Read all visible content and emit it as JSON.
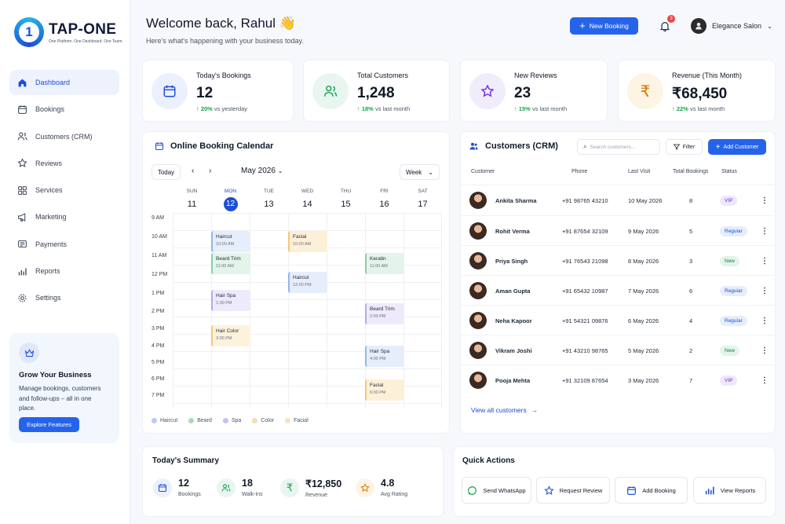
{
  "brand": {
    "name": "TAP-ONE",
    "tagline": "One Platform. One Dashboard. One Team."
  },
  "sidebar": {
    "items": [
      {
        "label": "Dashboard",
        "icon": "home-icon"
      },
      {
        "label": "Bookings",
        "icon": "calendar-icon"
      },
      {
        "label": "Customers (CRM)",
        "icon": "users-icon"
      },
      {
        "label": "Reviews",
        "icon": "star-icon"
      },
      {
        "label": "Services",
        "icon": "grid-icon"
      },
      {
        "label": "Marketing",
        "icon": "megaphone-icon"
      },
      {
        "label": "Payments",
        "icon": "payments-icon"
      },
      {
        "label": "Reports",
        "icon": "bar-chart-icon"
      },
      {
        "label": "Settings",
        "icon": "gear-icon"
      }
    ],
    "promo": {
      "title": "Grow Your Business",
      "text": "Manage bookings, customers and follow-ups – all in one place.",
      "button": "Explore Features"
    }
  },
  "header": {
    "title": "Welcome back, Rahul 👋",
    "subtitle": "Here's what's happening with your business today.",
    "new_booking": "New Booking",
    "notifications": "3",
    "salon": "Elegance Salon"
  },
  "stats": [
    {
      "label": "Today's Bookings",
      "value": "12",
      "change": "20%",
      "compare": "vs yesterday",
      "color": "#eaf0fd"
    },
    {
      "label": "Total Customers",
      "value": "1,248",
      "change": "18%",
      "compare": "vs last month",
      "color": "#e8f6ef"
    },
    {
      "label": "New Reviews",
      "value": "23",
      "change": "15%",
      "compare": "vs last month",
      "color": "#f0ecfb"
    },
    {
      "label": "Revenue (This Month)",
      "value": "₹68,450",
      "change": "22%",
      "compare": "vs last month",
      "color": "#fdf4e3"
    }
  ],
  "calendar": {
    "title": "Online Booking Calendar",
    "today": "Today",
    "month": "May 2026",
    "view": "Week",
    "days": [
      {
        "n": "SUN",
        "d": "11"
      },
      {
        "n": "MON",
        "d": "12"
      },
      {
        "n": "TUE",
        "d": "13"
      },
      {
        "n": "WED",
        "d": "14"
      },
      {
        "n": "THU",
        "d": "15"
      },
      {
        "n": "FRI",
        "d": "16"
      },
      {
        "n": "SAT",
        "d": "17"
      }
    ],
    "hours": [
      "9 AM",
      "10 AM",
      "11 AM",
      "12 PM",
      "1 PM",
      "2 PM",
      "3 PM",
      "4 PM",
      "5 PM",
      "6 PM",
      "7 PM"
    ],
    "events": [
      {
        "name": "Haircut",
        "time": "10:00 AM"
      },
      {
        "name": "Beard Trim",
        "time": "11:00 AM"
      },
      {
        "name": "Hair Spa",
        "time": "1:00 PM"
      },
      {
        "name": "Hair Color",
        "time": "3:00 PM"
      },
      {
        "name": "Facial",
        "time": "10:00 AM"
      },
      {
        "name": "Haircut",
        "time": "12:00 PM"
      },
      {
        "name": "Keratin",
        "time": "11:00 AM"
      },
      {
        "name": "Beard Trim",
        "time": "2:00 PM"
      },
      {
        "name": "Hair Spa",
        "time": "4:00 PM"
      },
      {
        "name": "Facial",
        "time": "6:00 PM"
      }
    ],
    "legend": [
      "Haircut",
      "Beard",
      "Spa",
      "Color",
      "Facial"
    ]
  },
  "crm": {
    "title": "Customers (CRM)",
    "search_placeholder": "Search customers...",
    "filter": "Filter",
    "add": "Add Customer",
    "columns": [
      "Customer",
      "Phone",
      "Last Visit",
      "Total Bookings",
      "Status"
    ],
    "rows": [
      {
        "name": "Ankita Sharma",
        "phone": "+91 98765 43210",
        "last": "10 May 2026",
        "total": "8",
        "status": "VIP"
      },
      {
        "name": "Rohit Verma",
        "phone": "+91 87654 32109",
        "last": "9 May 2026",
        "total": "5",
        "status": "Regular"
      },
      {
        "name": "Priya Singh",
        "phone": "+91 76543 21098",
        "last": "8 May 2026",
        "total": "3",
        "status": "New"
      },
      {
        "name": "Aman Gupta",
        "phone": "+91 65432 10987",
        "last": "7 May 2026",
        "total": "6",
        "status": "Regular"
      },
      {
        "name": "Neha Kapoor",
        "phone": "+91 54321 09876",
        "last": "6 May 2026",
        "total": "4",
        "status": "Regular"
      },
      {
        "name": "Vikram Joshi",
        "phone": "+91 43210 98765",
        "last": "5 May 2026",
        "total": "2",
        "status": "New"
      },
      {
        "name": "Pooja Mehta",
        "phone": "+91 32109 87654",
        "last": "3 May 2026",
        "total": "7",
        "status": "VIP"
      }
    ],
    "view_all": "View all customers"
  },
  "summary": {
    "title": "Today's Summary",
    "items": [
      {
        "value": "12",
        "label": "Bookings"
      },
      {
        "value": "18",
        "label": "Walk-ins"
      },
      {
        "value": "₹12,850",
        "label": "Revenue"
      },
      {
        "value": "4.8",
        "label": "Avg Rating"
      }
    ]
  },
  "quick": {
    "title": "Quick Actions",
    "items": [
      "Send WhatsApp",
      "Request Review",
      "Add Booking",
      "View Reports"
    ]
  }
}
